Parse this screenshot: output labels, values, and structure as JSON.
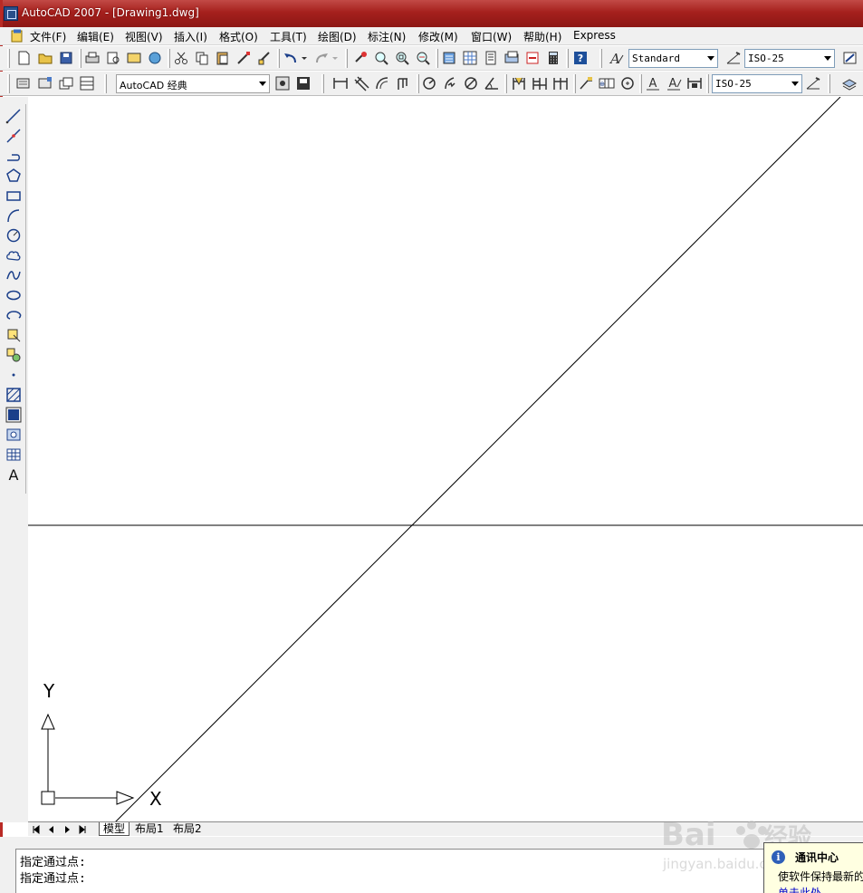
{
  "window": {
    "title": "AutoCAD 2007 - [Drawing1.dwg]"
  },
  "menu": {
    "items": [
      "文件(F)",
      "编辑(E)",
      "视图(V)",
      "插入(I)",
      "格式(O)",
      "工具(T)",
      "绘图(D)",
      "标注(N)",
      "修改(M)",
      "窗口(W)",
      "帮助(H)",
      "Express"
    ]
  },
  "toolbar": {
    "text_style": "Standard",
    "dim_style": "ISO-25",
    "workspace": "AutoCAD 经典",
    "dim_style_2": "ISO-25"
  },
  "ucs": {
    "x_label": "X",
    "y_label": "Y"
  },
  "tabs": {
    "model": "模型",
    "layout1": "布局1",
    "layout2": "布局2"
  },
  "command": {
    "line1": "指定通过点:",
    "line2": "指定通过点:"
  },
  "notification": {
    "title": "通讯中心",
    "body": "使软件保持最新的",
    "link": "单击此处。"
  },
  "watermark": {
    "brand": "Bai",
    "brand2": "经验",
    "url": "jingyan.baidu.com"
  },
  "colors": {
    "titlebar": "#a5201d",
    "chrome": "#f0f0f0",
    "canvas": "#ffffff"
  }
}
